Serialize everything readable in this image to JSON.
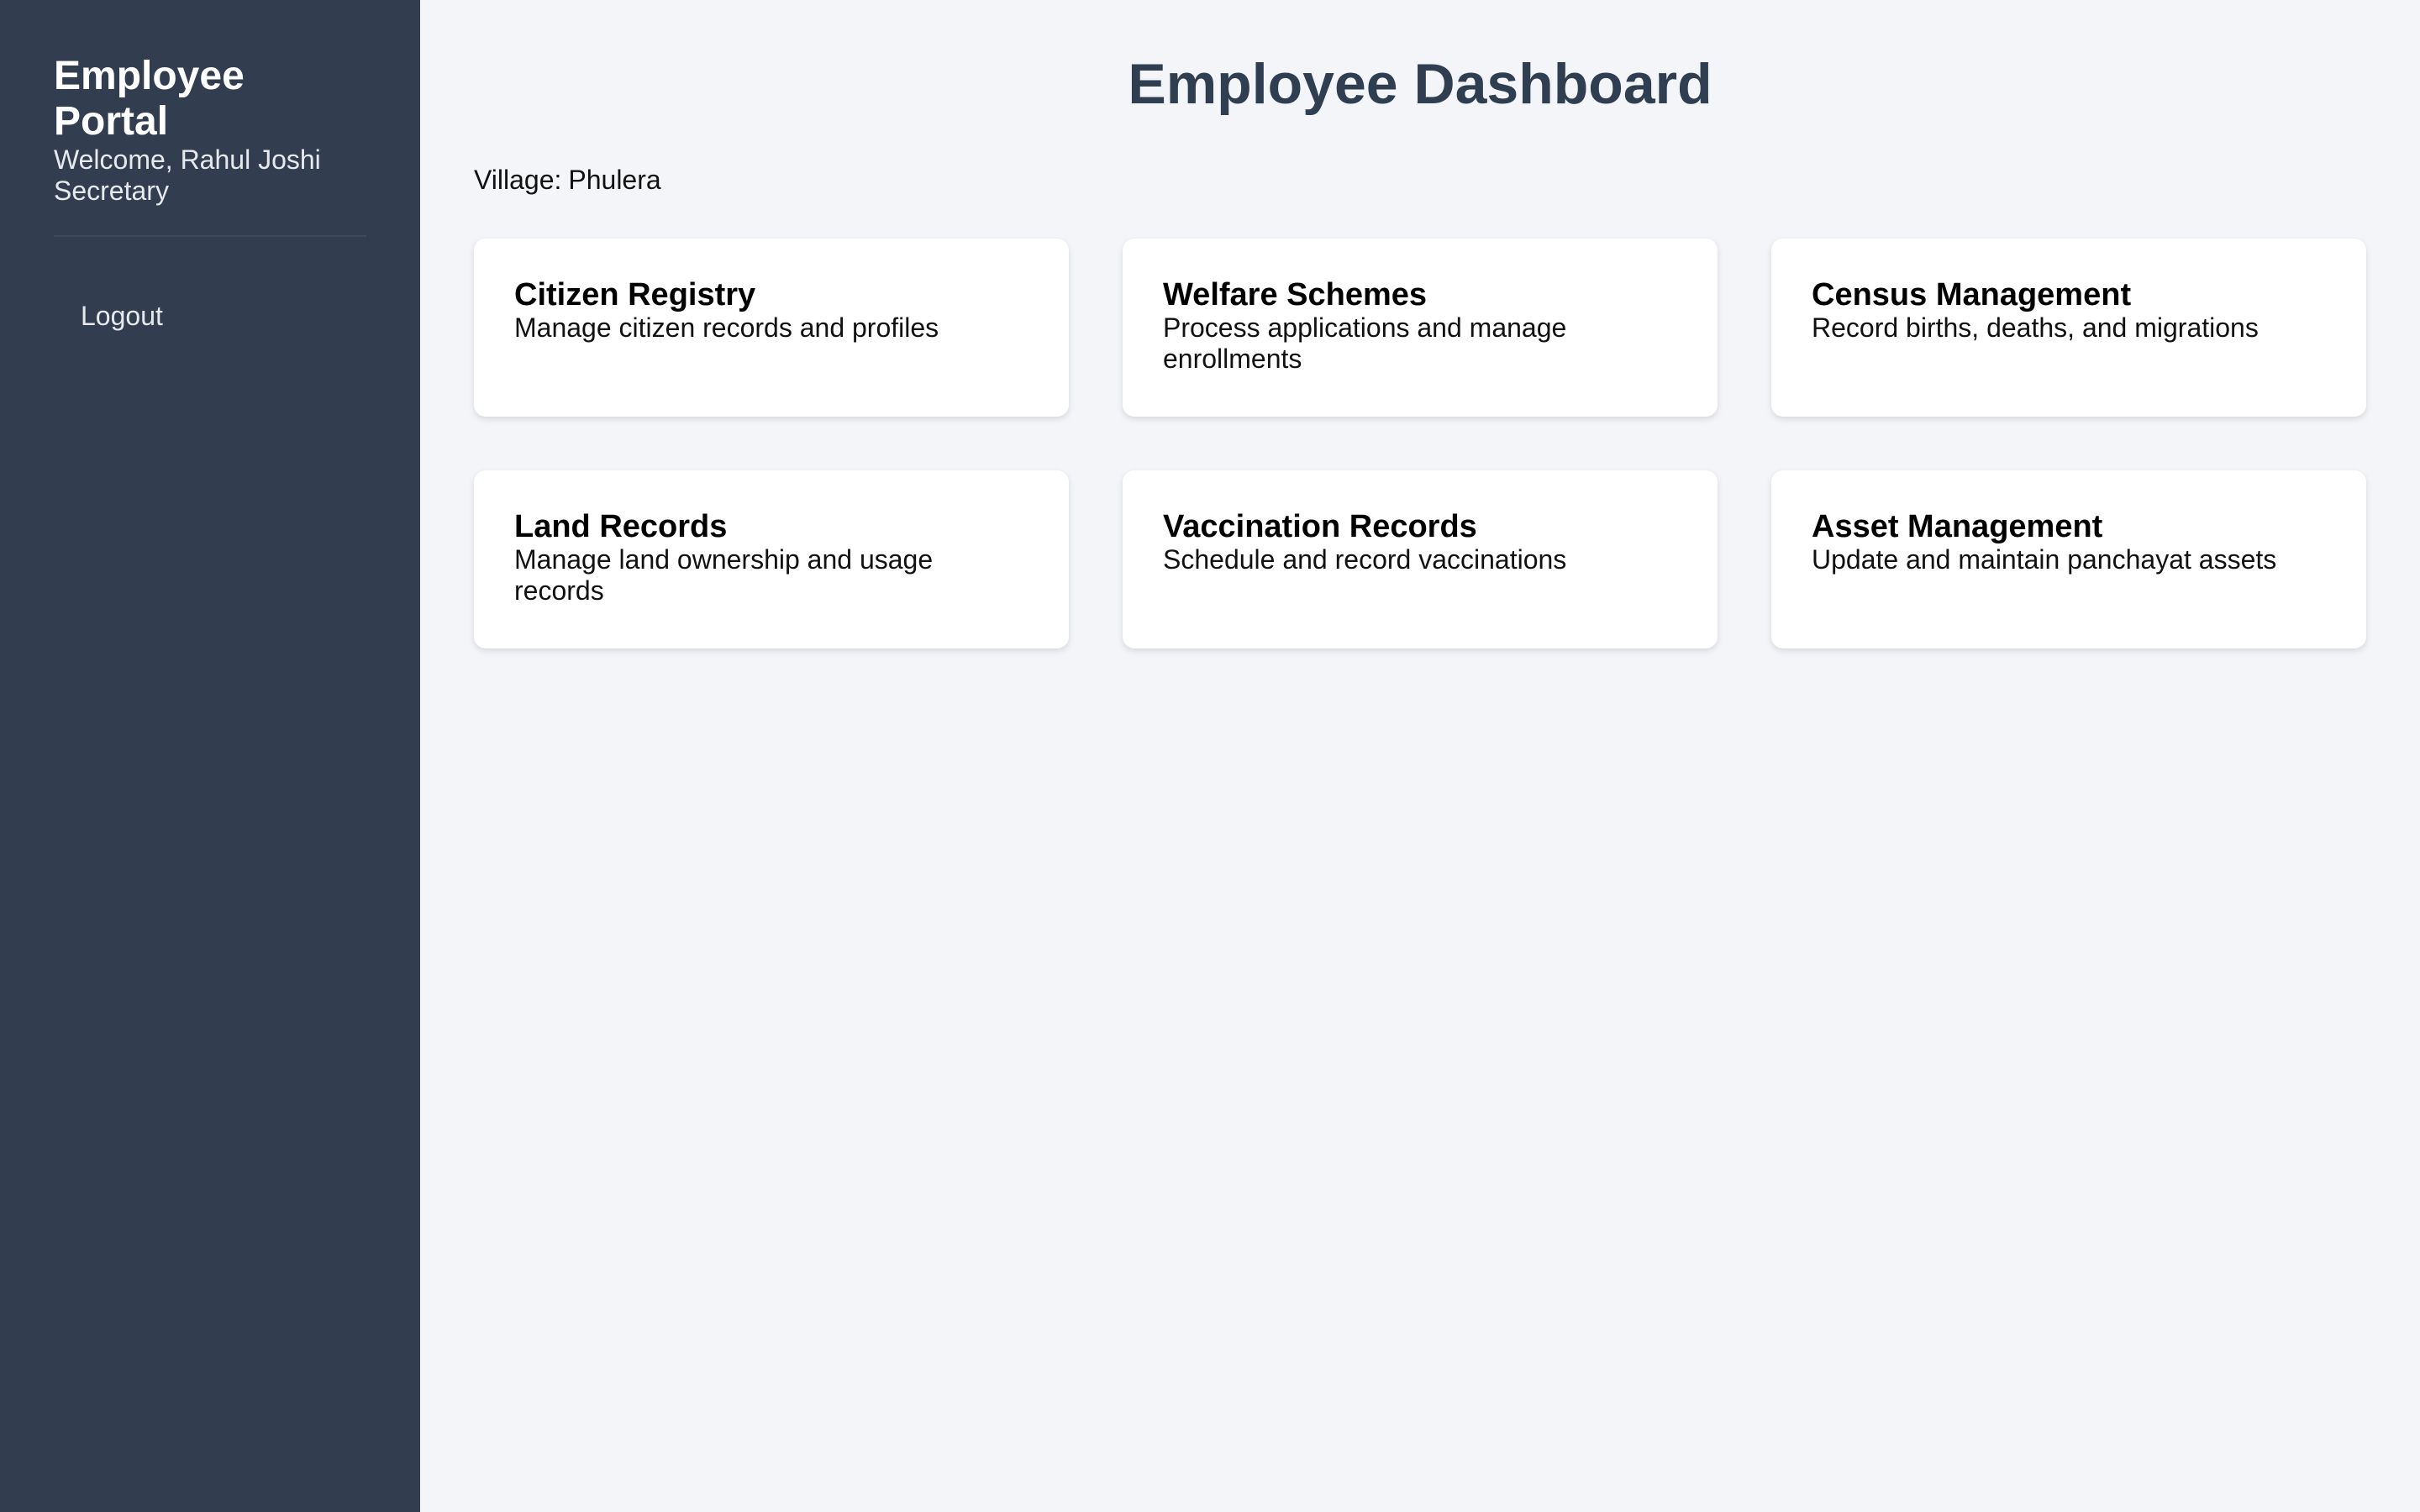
{
  "sidebar": {
    "title": "Employee Portal",
    "welcome": "Welcome, Rahul Joshi",
    "role": "Secretary",
    "logout_label": "Logout"
  },
  "main": {
    "title": "Employee Dashboard",
    "village_label": "Village:",
    "village_name": "Phulera",
    "cards": [
      {
        "title": "Citizen Registry",
        "description": "Manage citizen records and profiles"
      },
      {
        "title": "Welfare Schemes",
        "description": "Process applications and manage enrollments"
      },
      {
        "title": "Census Management",
        "description": "Record births, deaths, and migrations"
      },
      {
        "title": "Land Records",
        "description": "Manage land ownership and usage records"
      },
      {
        "title": "Vaccination Records",
        "description": "Schedule and record vaccinations"
      },
      {
        "title": "Asset Management",
        "description": "Update and maintain panchayat assets"
      }
    ]
  },
  "colors": {
    "sidebar_bg": "#323e4f",
    "main_bg": "#f3f5f9",
    "title_color": "#2f3e50",
    "card_bg": "#ffffff"
  }
}
